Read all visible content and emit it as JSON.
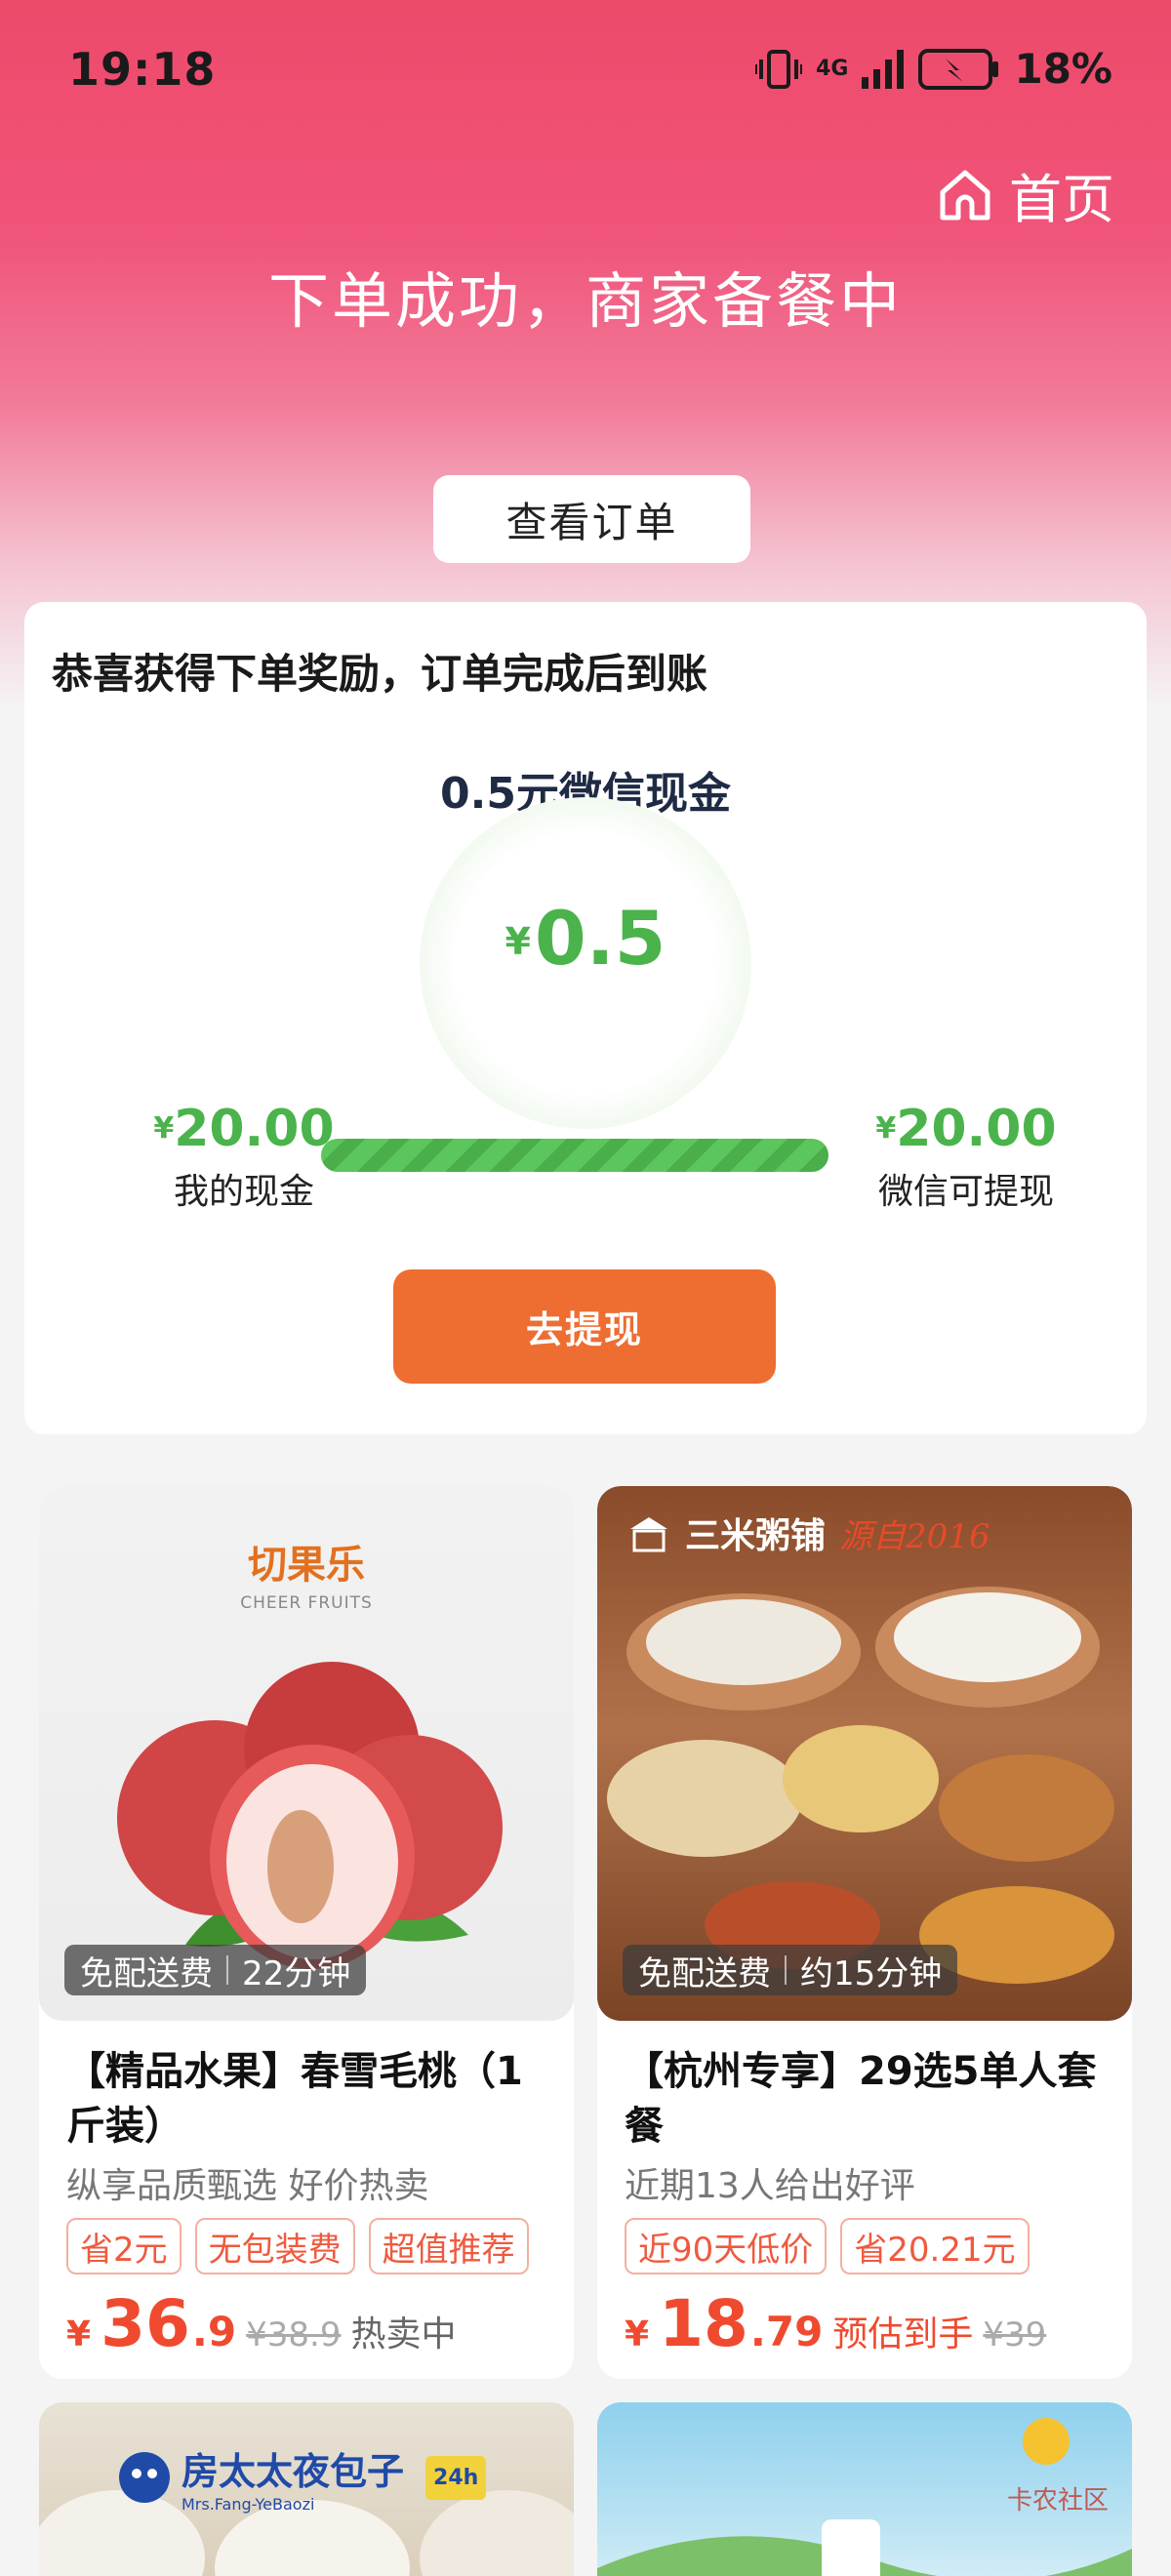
{
  "status_bar": {
    "time": "19:18",
    "network": "4G",
    "battery": "18%"
  },
  "header": {
    "home_label": "首页",
    "title": "下单成功，商家备餐中",
    "view_order_label": "查看订单"
  },
  "reward": {
    "heading": "恭喜获得下单奖励，订单完成后到账",
    "subtitle": "0.5元微信现金",
    "currency": "¥",
    "amount": "0.5",
    "my_cash_value": "20.00",
    "my_cash_label": "我的现金",
    "withdrawable_value": "20.00",
    "withdrawable_label": "微信可提现",
    "progress": 1.0,
    "withdraw_label": "去提现"
  },
  "products": [
    {
      "brand": "切果乐",
      "brand_en": "CHEER FRUITS",
      "delivery_fee": "免配送费",
      "delivery_time": "22分钟",
      "title": "【精品水果】春雪毛桃（1斤装）",
      "desc": "纵享品质甄选 好价热卖",
      "tags": [
        "省2元",
        "无包装费",
        "超值推荐"
      ],
      "price_int": "36",
      "price_dec": ".9",
      "old_price": "¥38.9",
      "note": "热卖中"
    },
    {
      "brand": "三米粥铺",
      "brand_slogan": "源自2016",
      "delivery_fee": "免配送费",
      "delivery_time": "约15分钟",
      "title": "【杭州专享】29选5单人套餐",
      "desc": "近期13人给出好评",
      "tags": [
        "近90天低价",
        "省20.21元"
      ],
      "price_int": "18",
      "price_dec": ".79",
      "note": "预估到手",
      "old_price": "¥39"
    },
    {
      "brand": "房太太夜包子",
      "brand_en": "Mrs.Fang-YeBaozi",
      "badge": "24h"
    },
    {
      "watermark": "卡农社区"
    }
  ]
}
